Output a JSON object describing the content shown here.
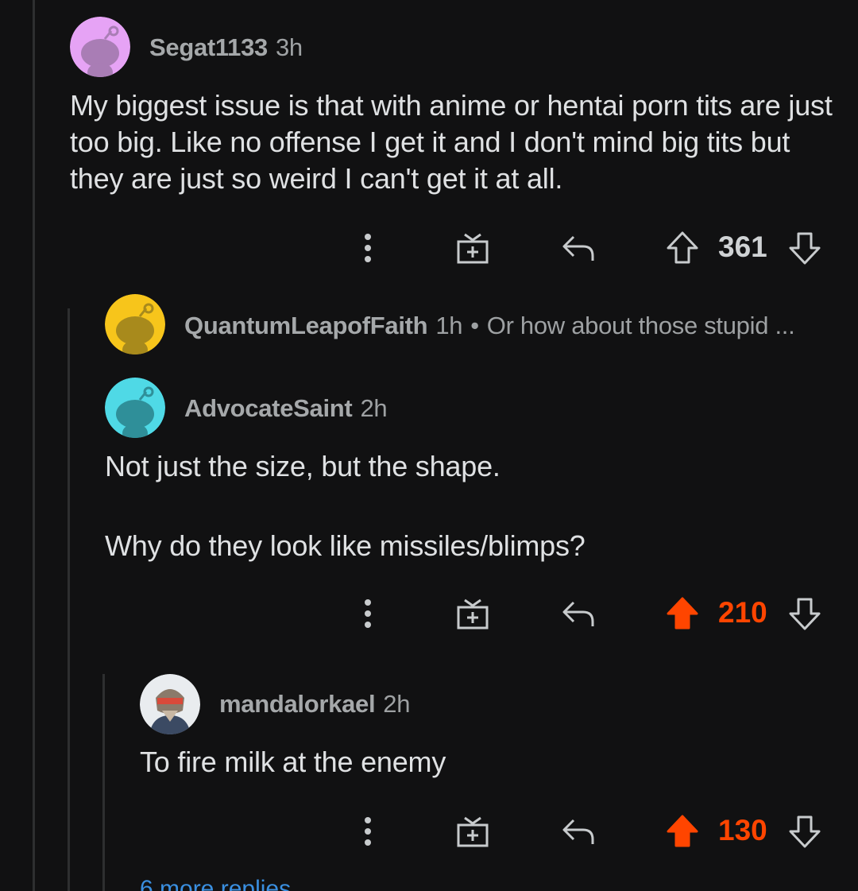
{
  "colors": {
    "upvote": "#ff4500",
    "link": "#3a8fe0",
    "background": "#111112"
  },
  "comments": [
    {
      "username": "Segat1133",
      "age": "3h",
      "avatar_color": "#e6a3f5",
      "avatar_icon": "snoo-avatar-icon",
      "body": [
        "My biggest issue is that with anime or hentai porn tits are just too big. Like no offense I get it and I don't mind big tits but they are just so weird I can't get it at all."
      ],
      "votes": "361",
      "upvoted": false
    },
    {
      "username": "QuantumLeapofFaith",
      "age": "1h",
      "separator": "•",
      "preview": "Or how about those stupid ...",
      "avatar_color": "#f7c51b",
      "avatar_icon": "snoo-avatar-icon",
      "collapsed": true
    },
    {
      "username": "AdvocateSaint",
      "age": "2h",
      "avatar_color": "#4fd9e6",
      "avatar_icon": "snoo-avatar-icon",
      "body": [
        "Not just the size, but the shape.",
        "Why do they look like missiles/blimps?"
      ],
      "votes": "210",
      "upvoted": true
    },
    {
      "username": "mandalorkael",
      "age": "2h",
      "avatar_icon": "soldier-avatar-icon",
      "body": [
        "To fire milk at the enemy"
      ],
      "votes": "130",
      "upvoted": true
    }
  ],
  "more_replies": "6 more replies",
  "icons": {
    "more": "more-options-icon",
    "award": "award-gift-icon",
    "reply": "reply-arrow-icon",
    "upvote": "upvote-arrow-icon",
    "downvote": "downvote-arrow-icon"
  }
}
